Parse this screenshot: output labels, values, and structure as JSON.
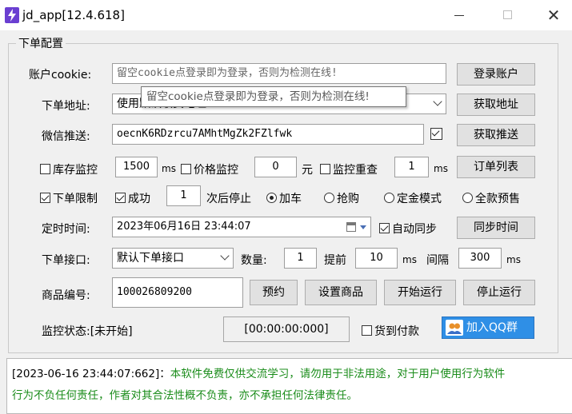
{
  "window": {
    "title": "jd_app[12.4.618]",
    "min": "—",
    "close": "✕"
  },
  "group": {
    "title": "下单配置"
  },
  "row1": {
    "label": "账户cookie:",
    "cookie_placeholder": "留空cookie点登录即为登录，否则为检测在线!",
    "login_button": "登录账户",
    "tooltip": "留空cookie点登录即为登录，否则为检测在线!"
  },
  "row2": {
    "label": "下单地址:",
    "address_value": "使用默认收货地址",
    "get_address_button": "获取地址"
  },
  "row3": {
    "label": "微信推送:",
    "wechat_value": "oecnK6RDzrcu7AMhtMgZk2FZlfwk",
    "get_push_button": "获取推送"
  },
  "row4": {
    "stock_monitor_label": "库存监控",
    "stock_ms_value": "1500",
    "ms_unit": "ms",
    "price_monitor_label": "价格监控",
    "price_value": "0",
    "yuan_unit": "元",
    "repeat_monitor_label": "监控重查",
    "repeat_value": "1",
    "ms_unit2": "ms",
    "order_list_button": "订单列表"
  },
  "row5": {
    "order_limit_label": "下单限制",
    "success_label": "成功",
    "success_count": "1",
    "stop_after_label": "次后停止",
    "mode_cart": "加车",
    "mode_rush": "抢购",
    "mode_deposit": "定金模式",
    "mode_full": "全款预售"
  },
  "row6": {
    "label": "定时时间:",
    "datetime_value": "2023年06月16日  23:44:07",
    "auto_sync_label": "自动同步",
    "sync_time_button": "同步时间"
  },
  "row7": {
    "label": "下单接口:",
    "interface_value": "默认下单接口",
    "quantity_label": "数量:",
    "quantity_value": "1",
    "advance_label": "提前",
    "advance_value": "10",
    "ms_unit": "ms",
    "interval_label": "间隔",
    "interval_value": "300",
    "ms_unit2": "ms"
  },
  "row8": {
    "label": "商品编号:",
    "product_id": "100026809200",
    "reserve_button": "预约",
    "set_product_button": "设置商品",
    "start_button": "开始运行",
    "stop_button": "停止运行"
  },
  "row9": {
    "status_label": "监控状态:[未开始]",
    "timer": "[00:00:00:000]",
    "cod_label": "货到付款",
    "qq_group_button": "加入QQ群"
  },
  "log": {
    "timestamp": "[2023-06-16 23:44:07:662]：",
    "message_line1": "本软件免费仅供交流学习，请勿用于非法用途，对于用户使用行为软件",
    "message_line2": "行为不负任何责任，作者对其合法性概不负责，亦不承担任何法律责任。"
  },
  "colors": {
    "log_message": "#1a8c1a",
    "qq_button": "#2f8fe6",
    "app_icon": "#6a3fd1"
  }
}
